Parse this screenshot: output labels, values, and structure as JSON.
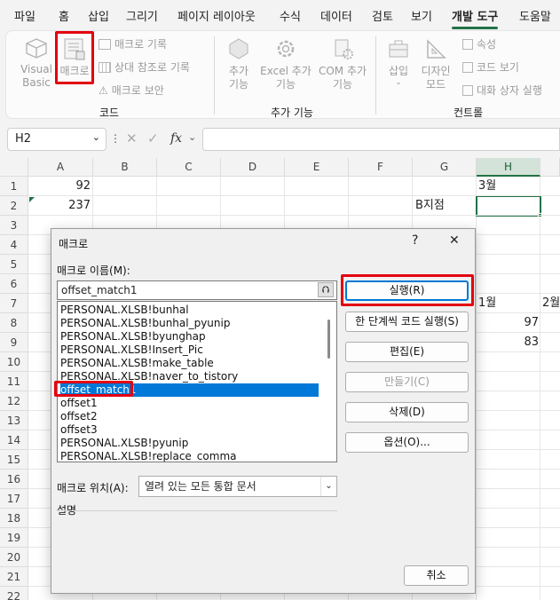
{
  "menu": {
    "tabs": [
      "파일",
      "홈",
      "삽입",
      "그리기",
      "페이지 레이아웃",
      "수식",
      "데이터",
      "검토",
      "보기",
      "개발 도구",
      "도움말"
    ],
    "active_tab": "개발 도구"
  },
  "ribbon": {
    "code": {
      "visual_basic": "Visual Basic",
      "macro": "매크로",
      "record_macro": "매크로 기록",
      "relative_ref": "상대 참조로 기록",
      "macro_security": "매크로 보안",
      "group_label": "코드"
    },
    "addins": {
      "addins_label": "추가 기능",
      "excel_addins": "Excel 추가 기능",
      "com_addins": "COM 추가 기능",
      "group_label": "추가 기능"
    },
    "controls": {
      "insert": "삽입",
      "design_mode": "디자인 모드",
      "properties": "속성",
      "view_code": "코드 보기",
      "run_dialog": "대화 상자 실행",
      "group_label": "컨트롤"
    }
  },
  "formula_bar": {
    "name_box": "H2",
    "fx": "fx",
    "formula": ""
  },
  "sheet": {
    "columns": [
      "A",
      "B",
      "C",
      "D",
      "E",
      "F",
      "G",
      "H"
    ],
    "selected_column": "H",
    "rows": [
      "1",
      "2",
      "3",
      "4",
      "5",
      "6",
      "7",
      "8",
      "9",
      "10",
      "11",
      "12",
      "13",
      "14",
      "15",
      "16",
      "17",
      "18",
      "19",
      "20",
      "21",
      "22"
    ],
    "cells": {
      "A1": "92",
      "A2": "237",
      "G2": "B지점",
      "H1": "3월",
      "H7": "1월",
      "I7": "2월",
      "H8": "97",
      "H9": "83"
    }
  },
  "dialog": {
    "title": "매크로",
    "help": "?",
    "close": "✕",
    "name_label": "매크로 이름(M):",
    "name_value": "offset_match1",
    "up_icon": "⮉",
    "macros": [
      "PERSONAL.XLSB!bunhal",
      "PERSONAL.XLSB!bunhal_pyunip",
      "PERSONAL.XLSB!byunghap",
      "PERSONAL.XLSB!Insert_Pic",
      "PERSONAL.XLSB!make_table",
      "PERSONAL.XLSB!naver_to_tistory",
      "offset_match1",
      "offset1",
      "offset2",
      "offset3",
      "PERSONAL.XLSB!pyunip",
      "PERSONAL.XLSB!replace_comma"
    ],
    "selected_index": 6,
    "buttons": {
      "run": "실행(R)",
      "step": "한 단계씩 코드 실행(S)",
      "edit": "편집(E)",
      "create": "만들기(C)",
      "delete": "삭제(D)",
      "options": "옵션(O)...",
      "cancel": "취소"
    },
    "location_label": "매크로 위치(A):",
    "location_value": "열려 있는 모든 통합 문서",
    "description_label": "설명"
  }
}
